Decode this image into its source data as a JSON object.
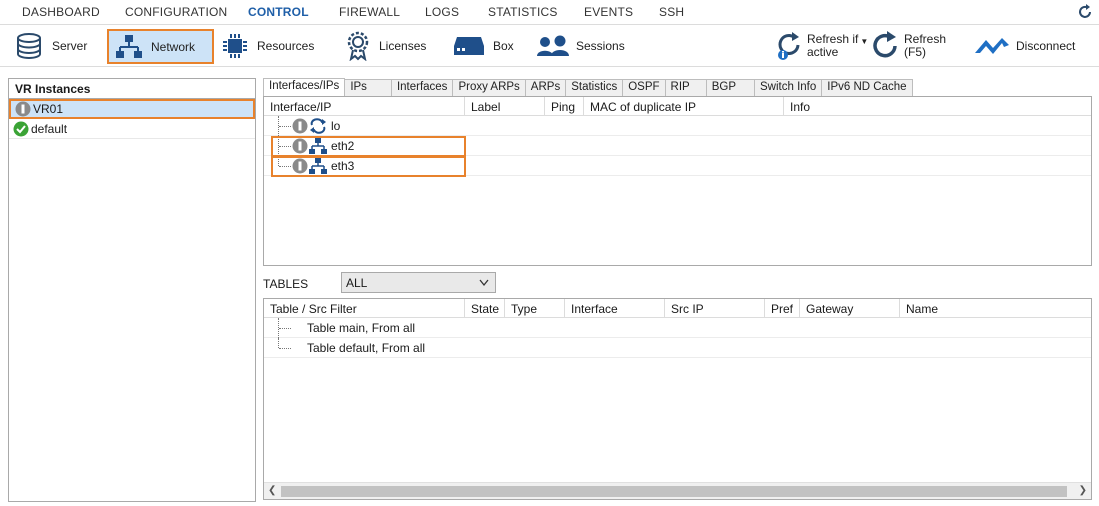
{
  "nav": {
    "items": [
      "DASHBOARD",
      "CONFIGURATION",
      "CONTROL",
      "FIREWALL",
      "LOGS",
      "STATISTICS",
      "EVENTS",
      "SSH"
    ],
    "active": "CONTROL"
  },
  "toolbar": {
    "server": "Server",
    "network": "Network",
    "resources": "Resources",
    "licenses": "Licenses",
    "box": "Box",
    "sessions": "Sessions",
    "refresh_if_active_1": "Refresh if",
    "refresh_if_active_2": "active",
    "refresh_1": "Refresh",
    "refresh_2": "(F5)",
    "disconnect": "Disconnect"
  },
  "vr_panel": {
    "title": "VR Instances",
    "items": [
      {
        "name": "VR01",
        "status": "info-icon",
        "selected": true
      },
      {
        "name": "default",
        "status": "check-icon",
        "selected": false
      }
    ]
  },
  "tabs": [
    "Interfaces/IPs",
    "IPs",
    "Interfaces",
    "Proxy ARPs",
    "ARPs",
    "Statistics",
    "OSPF",
    "RIP",
    "BGP",
    "Switch Info",
    "IPv6 ND Cache"
  ],
  "interfaces": {
    "columns": [
      "Interface/IP",
      "Label",
      "Ping",
      "MAC of duplicate IP",
      "Info"
    ],
    "rows": [
      {
        "name": "lo",
        "icon": "loopback-icon"
      },
      {
        "name": "eth2",
        "icon": "network-icon"
      },
      {
        "name": "eth3",
        "icon": "network-icon"
      }
    ]
  },
  "tables_filter": {
    "label": "TABLES",
    "value": "ALL"
  },
  "routes": {
    "columns": [
      "Table / Src Filter",
      "State",
      "Type",
      "Interface",
      "Src IP",
      "Pref",
      "Gateway",
      "Name"
    ],
    "rows": [
      {
        "name": "Table main, From all"
      },
      {
        "name": "Table default, From all"
      }
    ]
  },
  "colors": {
    "accent": "#1f5fa8",
    "highlight_border": "#e8822c",
    "selection_bg": "#cde3f7",
    "ok_green": "#3aa335",
    "info_grey": "#8a8a8a"
  }
}
